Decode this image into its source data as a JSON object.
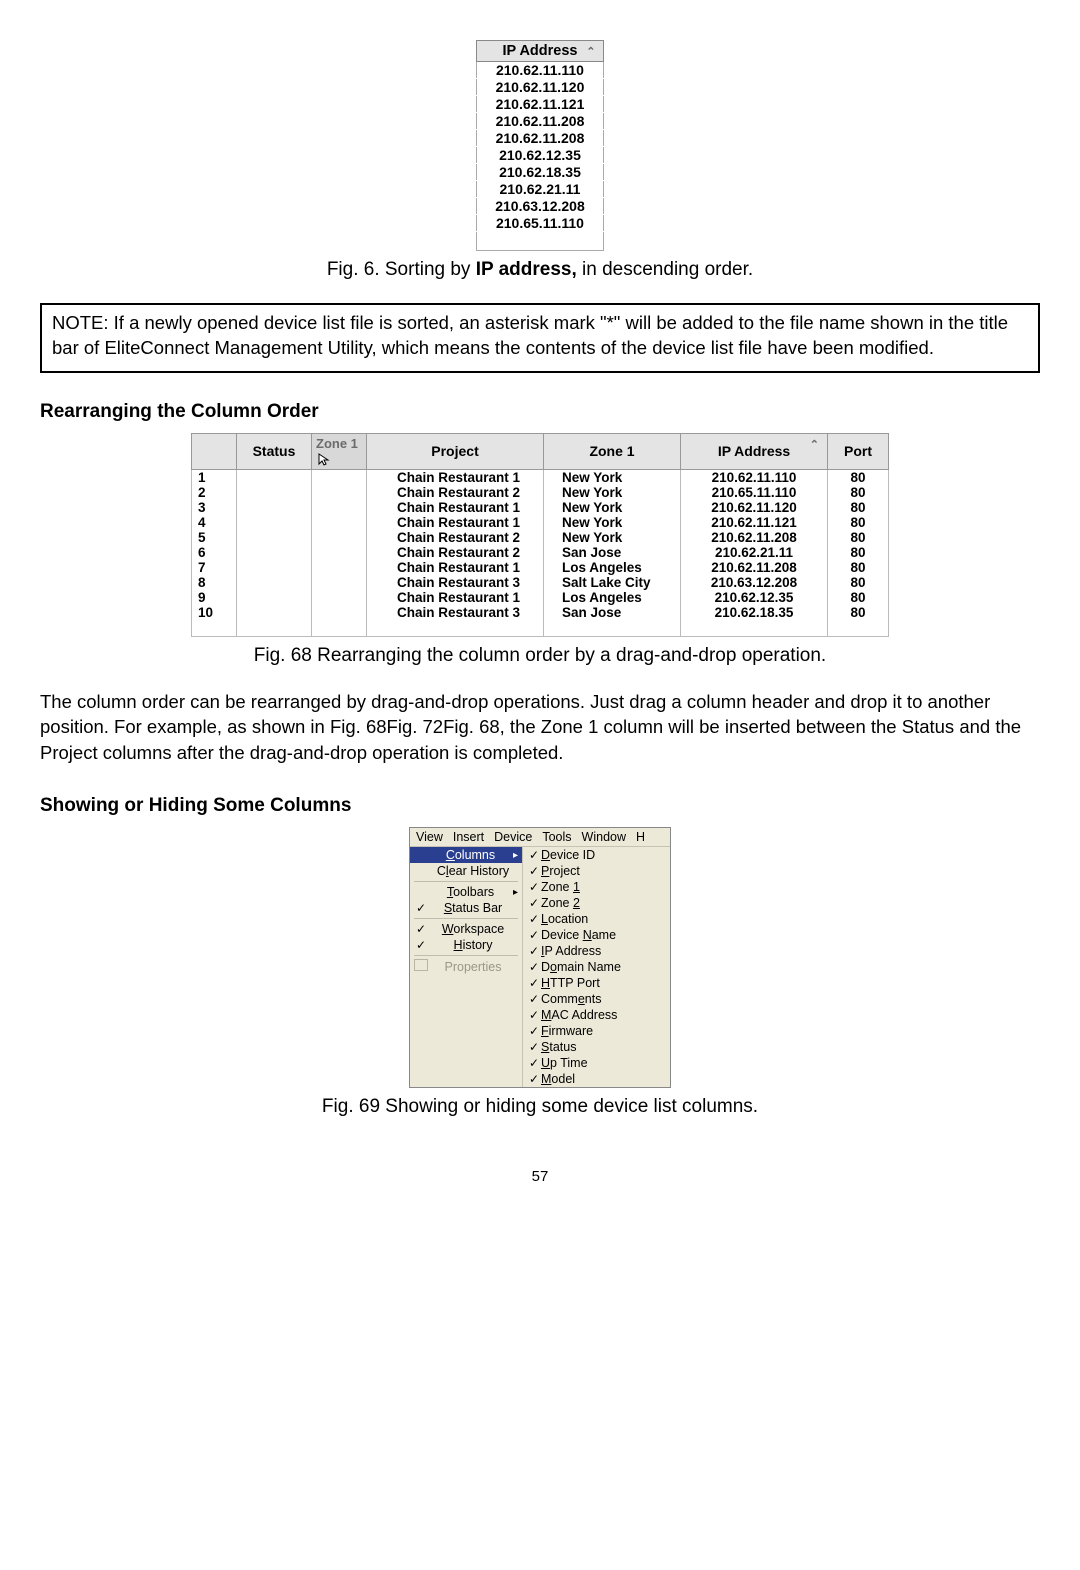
{
  "fig6": {
    "header": "IP Address",
    "rows": [
      "210.62.11.110",
      "210.62.11.120",
      "210.62.11.121",
      "210.62.11.208",
      "210.62.11.208",
      "210.62.12.35",
      "210.62.18.35",
      "210.62.21.11",
      "210.63.12.208",
      "210.65.11.110"
    ],
    "caption_prefix": "Fig. 6. Sorting by ",
    "caption_bold": "IP address,",
    "caption_suffix": " in descending order."
  },
  "note": {
    "label": "NOTE:",
    "text": " If a newly opened device list file is sorted, an asterisk mark \"*\" will be added to the file name shown in the title bar of EliteConnect Management Utility, which means the contents of the device list file have been modified."
  },
  "section_rearr": "Rearranging the Column Order",
  "fig68": {
    "headers": {
      "rownum": "",
      "status": "Status",
      "ghost": "Zone 1",
      "project": "Project",
      "zone1": "Zone 1",
      "ip": "IP Address",
      "port": "Port"
    },
    "rows": [
      {
        "n": "1",
        "proj": "Chain Restaurant 1",
        "zone": "New York",
        "ip": "210.62.11.110",
        "port": "80"
      },
      {
        "n": "2",
        "proj": "Chain Restaurant 2",
        "zone": "New York",
        "ip": "210.65.11.110",
        "port": "80"
      },
      {
        "n": "3",
        "proj": "Chain Restaurant 1",
        "zone": "New York",
        "ip": "210.62.11.120",
        "port": "80"
      },
      {
        "n": "4",
        "proj": "Chain Restaurant 1",
        "zone": "New York",
        "ip": "210.62.11.121",
        "port": "80"
      },
      {
        "n": "5",
        "proj": "Chain Restaurant 2",
        "zone": "New York",
        "ip": "210.62.11.208",
        "port": "80"
      },
      {
        "n": "6",
        "proj": "Chain Restaurant 2",
        "zone": "San Jose",
        "ip": "210.62.21.11",
        "port": "80"
      },
      {
        "n": "7",
        "proj": "Chain Restaurant 1",
        "zone": "Los Angeles",
        "ip": "210.62.11.208",
        "port": "80"
      },
      {
        "n": "8",
        "proj": "Chain Restaurant 3",
        "zone": "Salt Lake City",
        "ip": "210.63.12.208",
        "port": "80"
      },
      {
        "n": "9",
        "proj": "Chain Restaurant 1",
        "zone": "Los Angeles",
        "ip": "210.62.12.35",
        "port": "80"
      },
      {
        "n": "10",
        "proj": "Chain Restaurant 3",
        "zone": "San Jose",
        "ip": "210.62.18.35",
        "port": "80"
      }
    ],
    "caption": "Fig. 68 Rearranging the column order by a drag-and-drop operation."
  },
  "para1": "The column order can be rearranged by drag-and-drop operations. Just drag a column header and drop it to another position. For example, as shown in Fig. 68Fig. 72Fig. 68, the Zone 1 column will be inserted between the Status and the Project columns after the drag-and-drop operation is completed.",
  "section_showhide": "Showing or Hiding Some Columns",
  "fig69": {
    "menubar": [
      "View",
      "Insert",
      "Device",
      "Tools",
      "Window",
      "H"
    ],
    "left": [
      {
        "type": "hl",
        "label": "Columns",
        "u": "C",
        "arrow": true
      },
      {
        "type": "row",
        "label": "Clear History",
        "u": "l"
      },
      {
        "type": "sep"
      },
      {
        "type": "row",
        "label": "Toolbars",
        "u": "T",
        "arrow": true
      },
      {
        "type": "chk",
        "label": "Status Bar",
        "u": "S"
      },
      {
        "type": "sep"
      },
      {
        "type": "chk",
        "label": "Workspace",
        "u": "W"
      },
      {
        "type": "chk",
        "label": "History",
        "u": "H"
      },
      {
        "type": "sep"
      },
      {
        "type": "disabled",
        "label": "Properties"
      }
    ],
    "right": [
      {
        "label": "Device ID",
        "u": "D"
      },
      {
        "label": "Project",
        "u": "P"
      },
      {
        "label": "Zone 1",
        "u": "1"
      },
      {
        "label": "Zone 2",
        "u": "2"
      },
      {
        "label": "Location",
        "u": "L"
      },
      {
        "label": "Device Name",
        "u": "N"
      },
      {
        "label": "IP Address",
        "u": "I"
      },
      {
        "label": "Domain Name",
        "u": "o"
      },
      {
        "label": "HTTP Port",
        "u": "H"
      },
      {
        "label": "Comments",
        "u": "e"
      },
      {
        "label": "MAC Address",
        "u": "M"
      },
      {
        "label": "Firmware",
        "u": "F"
      },
      {
        "label": "Status",
        "u": "S"
      },
      {
        "label": "Up Time",
        "u": "U"
      },
      {
        "label": "Model",
        "u": "M"
      }
    ],
    "caption": "Fig. 69 Showing or hiding some device list columns."
  },
  "page_number": "57"
}
